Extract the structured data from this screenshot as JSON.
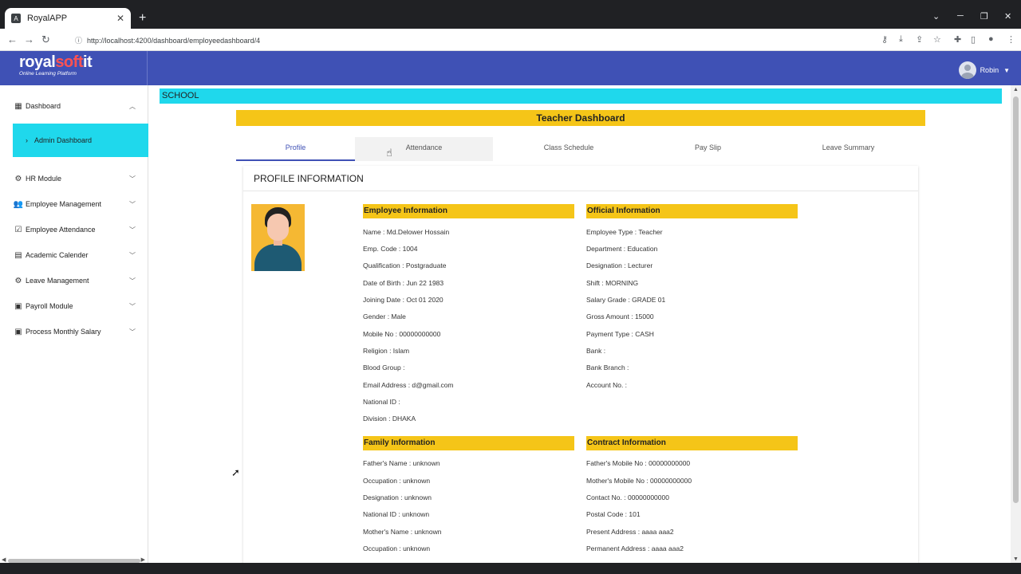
{
  "browser": {
    "tab_title": "RoyalAPP",
    "url": "http://localhost:4200/dashboard/employeedashboard/4"
  },
  "app": {
    "logo_main": "royal",
    "logo_accent": "soft",
    "logo_tail": "it",
    "tagline": "Online Learning Platform",
    "user_name": "Robin"
  },
  "sidebar": {
    "items": [
      {
        "label": "Dashboard",
        "icon": "grid-icon"
      },
      {
        "label": "HR Module",
        "icon": "hr-icon"
      },
      {
        "label": "Employee Management",
        "icon": "people-icon"
      },
      {
        "label": "Employee Attendance",
        "icon": "checkbox-icon"
      },
      {
        "label": "Academic Calender",
        "icon": "calendar-icon"
      },
      {
        "label": "Leave Management",
        "icon": "gear-icon"
      },
      {
        "label": "Payroll Module",
        "icon": "cash-icon"
      },
      {
        "label": "Process Monthly Salary",
        "icon": "cash-icon"
      }
    ],
    "sub_item": "Admin Dashboard"
  },
  "main": {
    "school_label": "SCHOOL",
    "title": "Teacher Dashboard",
    "tabs": [
      "Profile",
      "Attendance",
      "Class Schedule",
      "Pay Slip",
      "Leave Summary"
    ],
    "active_tab": "Profile",
    "card_title": "PROFILE INFORMATION"
  },
  "employee_info": {
    "heading": "Employee Information",
    "fields": [
      "Name : Md.Delower Hossain",
      "Emp. Code : 1004",
      "Qualification : Postgraduate",
      "Date of Birth : Jun 22 1983",
      "Joining Date : Oct 01 2020",
      "Gender : Male",
      "Mobile No : 00000000000",
      "Religion : Islam",
      "Blood Group :",
      "Email Address : d@gmail.com",
      "National ID :",
      "Division : DHAKA"
    ]
  },
  "official_info": {
    "heading": "Official Information",
    "fields": [
      "Employee Type : Teacher",
      "Department : Education",
      "Designation : Lecturer",
      "Shift : MORNING",
      "Salary Grade : GRADE 01",
      "Gross Amount : 15000",
      "Payment Type : CASH",
      "Bank :",
      "Bank Branch :",
      "Account No. :"
    ]
  },
  "family_info": {
    "heading": "Family Information",
    "fields": [
      "Father's Name : unknown",
      "Occupation : unknown",
      "Designation : unknown",
      "National ID : unknown",
      "Mother's Name : unknown",
      "Occupation : unknown"
    ]
  },
  "contract_info": {
    "heading": "Contract Information",
    "fields": [
      "Father's Mobile No : 00000000000",
      "Mother's Mobile No : 00000000000",
      "Contact No. : 00000000000",
      "Postal Code : 101",
      "Present Address : aaaa aaa2",
      "Permanent Address : aaaa aaa2"
    ]
  },
  "colors": {
    "header": "#3f51b5",
    "cyan": "#1fd8ec",
    "yellow": "#f5c518"
  }
}
